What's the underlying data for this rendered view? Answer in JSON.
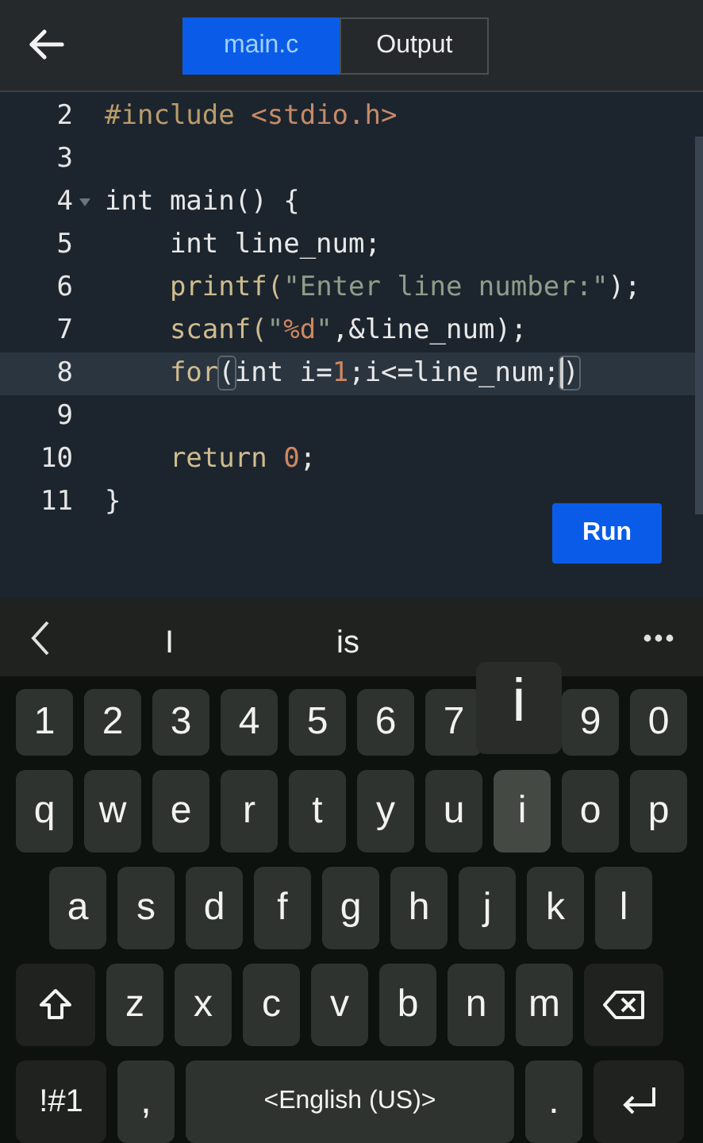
{
  "header": {
    "tabs": [
      {
        "label": "main.c",
        "selected": true
      },
      {
        "label": "Output",
        "selected": false
      }
    ]
  },
  "editor": {
    "lines": [
      {
        "number": "2",
        "fold": false,
        "active": false,
        "tokens": [
          {
            "text": "#include ",
            "kind": "preproc"
          },
          {
            "text": "<stdio.h>",
            "kind": "header"
          }
        ]
      },
      {
        "number": "3",
        "fold": false,
        "active": false
      },
      {
        "number": "4",
        "fold": true,
        "active": false,
        "tokens": [
          {
            "text": "int main() {",
            "kind": "plain"
          }
        ]
      },
      {
        "number": "5",
        "fold": false,
        "active": false,
        "tokens": [
          {
            "text": "    int line_num;",
            "kind": "plain"
          }
        ]
      },
      {
        "number": "6",
        "fold": false,
        "active": false,
        "tokens": [
          {
            "text": "    printf(",
            "kind": "func"
          },
          {
            "text": "\"Enter line number:\"",
            "kind": "string"
          },
          {
            "text": ");",
            "kind": "plain"
          }
        ]
      },
      {
        "number": "7",
        "fold": false,
        "active": false,
        "tokens": [
          {
            "text": "    scanf(",
            "kind": "func"
          },
          {
            "text": "\"",
            "kind": "string"
          },
          {
            "text": "%d",
            "kind": "number"
          },
          {
            "text": "\"",
            "kind": "string"
          },
          {
            "text": ",&line_num);",
            "kind": "plain"
          }
        ]
      },
      {
        "number": "8",
        "fold": false,
        "active": true,
        "tokens": [
          {
            "text": "    for",
            "kind": "func"
          },
          {
            "text": "(",
            "kind": "bracket"
          },
          {
            "text": "int i=",
            "kind": "plain"
          },
          {
            "text": "1",
            "kind": "number"
          },
          {
            "text": ";i<=line_num;",
            "kind": "plain"
          },
          {
            "text": ")",
            "kind": "bracket",
            "cursor": true
          }
        ]
      },
      {
        "number": "9",
        "fold": false,
        "active": false
      },
      {
        "number": "10",
        "fold": false,
        "active": false,
        "tokens": [
          {
            "text": "    return ",
            "kind": "func"
          },
          {
            "text": "0",
            "kind": "number"
          },
          {
            "text": ";",
            "kind": "plain"
          }
        ]
      },
      {
        "number": "11",
        "fold": false,
        "active": false,
        "tokens": [
          {
            "text": "}",
            "kind": "plain"
          }
        ]
      }
    ],
    "run_button": "Run"
  },
  "keyboard": {
    "suggestions": [
      "I",
      "is"
    ],
    "rows": [
      [
        {
          "kind": "char",
          "label": "1",
          "pressed": false
        },
        {
          "kind": "char",
          "label": "2",
          "pressed": false
        },
        {
          "kind": "char",
          "label": "3",
          "pressed": false
        },
        {
          "kind": "char",
          "label": "4",
          "pressed": false
        },
        {
          "kind": "char",
          "label": "5",
          "pressed": false
        },
        {
          "kind": "char",
          "label": "6",
          "pressed": false
        },
        {
          "kind": "char",
          "label": "7",
          "pressed": false
        },
        {
          "kind": "popup",
          "label": "i"
        },
        {
          "kind": "char",
          "label": "9",
          "pressed": false
        },
        {
          "kind": "char",
          "label": "0",
          "pressed": false
        }
      ],
      [
        {
          "kind": "char",
          "label": "q",
          "pressed": false
        },
        {
          "kind": "char",
          "label": "w",
          "pressed": false
        },
        {
          "kind": "char",
          "label": "e",
          "pressed": false
        },
        {
          "kind": "char",
          "label": "r",
          "pressed": false
        },
        {
          "kind": "char",
          "label": "t",
          "pressed": false
        },
        {
          "kind": "char",
          "label": "y",
          "pressed": false
        },
        {
          "kind": "char",
          "label": "u",
          "pressed": false
        },
        {
          "kind": "char",
          "label": "i",
          "pressed": true
        },
        {
          "kind": "char",
          "label": "o",
          "pressed": false
        },
        {
          "kind": "char",
          "label": "p",
          "pressed": false
        }
      ],
      [
        {
          "kind": "char",
          "label": "a",
          "pressed": false
        },
        {
          "kind": "char",
          "label": "s",
          "pressed": false
        },
        {
          "kind": "char",
          "label": "d",
          "pressed": false
        },
        {
          "kind": "char",
          "label": "f",
          "pressed": false
        },
        {
          "kind": "char",
          "label": "g",
          "pressed": false
        },
        {
          "kind": "char",
          "label": "h",
          "pressed": false
        },
        {
          "kind": "char",
          "label": "j",
          "pressed": false
        },
        {
          "kind": "char",
          "label": "k",
          "pressed": false
        },
        {
          "kind": "char",
          "label": "l",
          "pressed": false
        }
      ],
      [
        {
          "kind": "shift"
        },
        {
          "kind": "char",
          "label": "z",
          "pressed": false
        },
        {
          "kind": "char",
          "label": "x",
          "pressed": false
        },
        {
          "kind": "char",
          "label": "c",
          "pressed": false
        },
        {
          "kind": "char",
          "label": "v",
          "pressed": false
        },
        {
          "kind": "char",
          "label": "b",
          "pressed": false
        },
        {
          "kind": "char",
          "label": "n",
          "pressed": false
        },
        {
          "kind": "char",
          "label": "m",
          "pressed": false
        },
        {
          "kind": "backspace"
        }
      ]
    ],
    "bottom_bar": {
      "symbols_key": "!#1",
      "comma_key": ",",
      "space_bar": {
        "prev": "<",
        "label": "English (US)",
        "next": ">"
      },
      "period_key": "."
    }
  }
}
